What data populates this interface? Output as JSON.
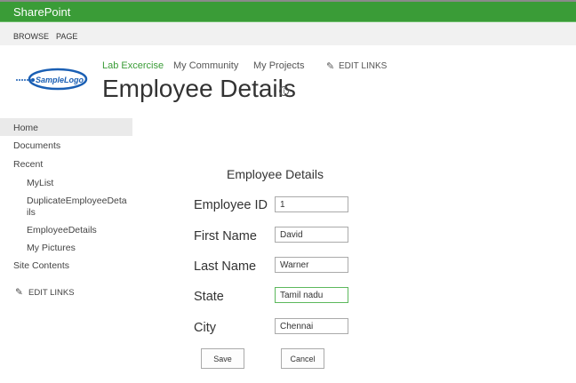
{
  "app": {
    "title": "SharePoint"
  },
  "ribbon": {
    "tabs": [
      "BROWSE",
      "PAGE"
    ]
  },
  "logo": {
    "text": "SampleLogo"
  },
  "top_nav": {
    "links": [
      "Lab Excercise",
      "My Community",
      "My Projects"
    ],
    "edit_links": "EDIT LINKS"
  },
  "page": {
    "title": "Employee Details"
  },
  "sidebar": {
    "items": [
      "Home",
      "Documents",
      "Recent",
      "MyList",
      "DuplicateEmployeeDeta",
      "ils",
      "EmployeeDetails",
      "My Pictures",
      "Site Contents"
    ],
    "edit_links": "EDIT LINKS"
  },
  "form": {
    "title": "Employee Details",
    "fields": [
      {
        "label": "Employee ID",
        "value": "1"
      },
      {
        "label": "First Name",
        "value": "David"
      },
      {
        "label": "Last Name",
        "value": "Warner"
      },
      {
        "label": "State",
        "value": "Tamil nadu"
      },
      {
        "label": "City",
        "value": "Chennai"
      }
    ],
    "save": "Save",
    "cancel": "Cancel"
  },
  "colors": {
    "brand": "#3a9c37",
    "link_active": "#3a9c37"
  }
}
